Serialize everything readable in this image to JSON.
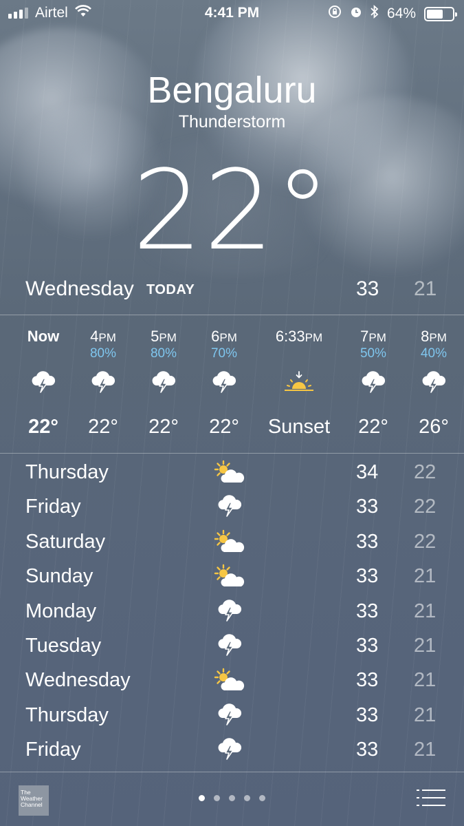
{
  "status_bar": {
    "carrier": "Airtel",
    "time": "4:41 PM",
    "battery": "64%",
    "battery_level": 0.64,
    "signal_bars": 3
  },
  "header": {
    "city": "Bengaluru",
    "condition": "Thunderstorm",
    "temperature": "22°"
  },
  "today": {
    "day": "Wednesday",
    "tag": "TODAY",
    "high": "33",
    "low": "21"
  },
  "hourly": [
    {
      "time": "Now",
      "suffix": "",
      "chance": "",
      "icon": "thunderstorm-icon",
      "temp": "22°"
    },
    {
      "time": "4",
      "suffix": "PM",
      "chance": "80%",
      "icon": "thunderstorm-icon",
      "temp": "22°"
    },
    {
      "time": "5",
      "suffix": "PM",
      "chance": "80%",
      "icon": "thunderstorm-icon",
      "temp": "22°"
    },
    {
      "time": "6",
      "suffix": "PM",
      "chance": "70%",
      "icon": "thunderstorm-icon",
      "temp": "22°"
    },
    {
      "time": "6:33",
      "suffix": "PM",
      "chance": "",
      "icon": "sunset-icon",
      "temp": "Sunset"
    },
    {
      "time": "7",
      "suffix": "PM",
      "chance": "50%",
      "icon": "thunderstorm-icon",
      "temp": "22°"
    },
    {
      "time": "8",
      "suffix": "PM",
      "chance": "40%",
      "icon": "thunderstorm-icon",
      "temp": "26°"
    }
  ],
  "daily": [
    {
      "day": "Thursday",
      "icon": "partly-cloudy-icon",
      "high": "34",
      "low": "22"
    },
    {
      "day": "Friday",
      "icon": "thunderstorm-icon",
      "high": "33",
      "low": "22"
    },
    {
      "day": "Saturday",
      "icon": "partly-cloudy-icon",
      "high": "33",
      "low": "22"
    },
    {
      "day": "Sunday",
      "icon": "partly-cloudy-icon",
      "high": "33",
      "low": "21"
    },
    {
      "day": "Monday",
      "icon": "thunderstorm-icon",
      "high": "33",
      "low": "21"
    },
    {
      "day": "Tuesday",
      "icon": "thunderstorm-icon",
      "high": "33",
      "low": "21"
    },
    {
      "day": "Wednesday",
      "icon": "partly-cloudy-icon",
      "high": "33",
      "low": "21"
    },
    {
      "day": "Thursday",
      "icon": "thunderstorm-icon",
      "high": "33",
      "low": "21"
    },
    {
      "day": "Friday",
      "icon": "thunderstorm-icon",
      "high": "33",
      "low": "21"
    }
  ],
  "footer": {
    "logo_text": "The Weather Channel",
    "page_count": 5,
    "active_page": 1
  },
  "colors": {
    "precip_blue": "#7fc6ee",
    "sun_yellow": "#f6c644",
    "background": "#5a6878"
  }
}
